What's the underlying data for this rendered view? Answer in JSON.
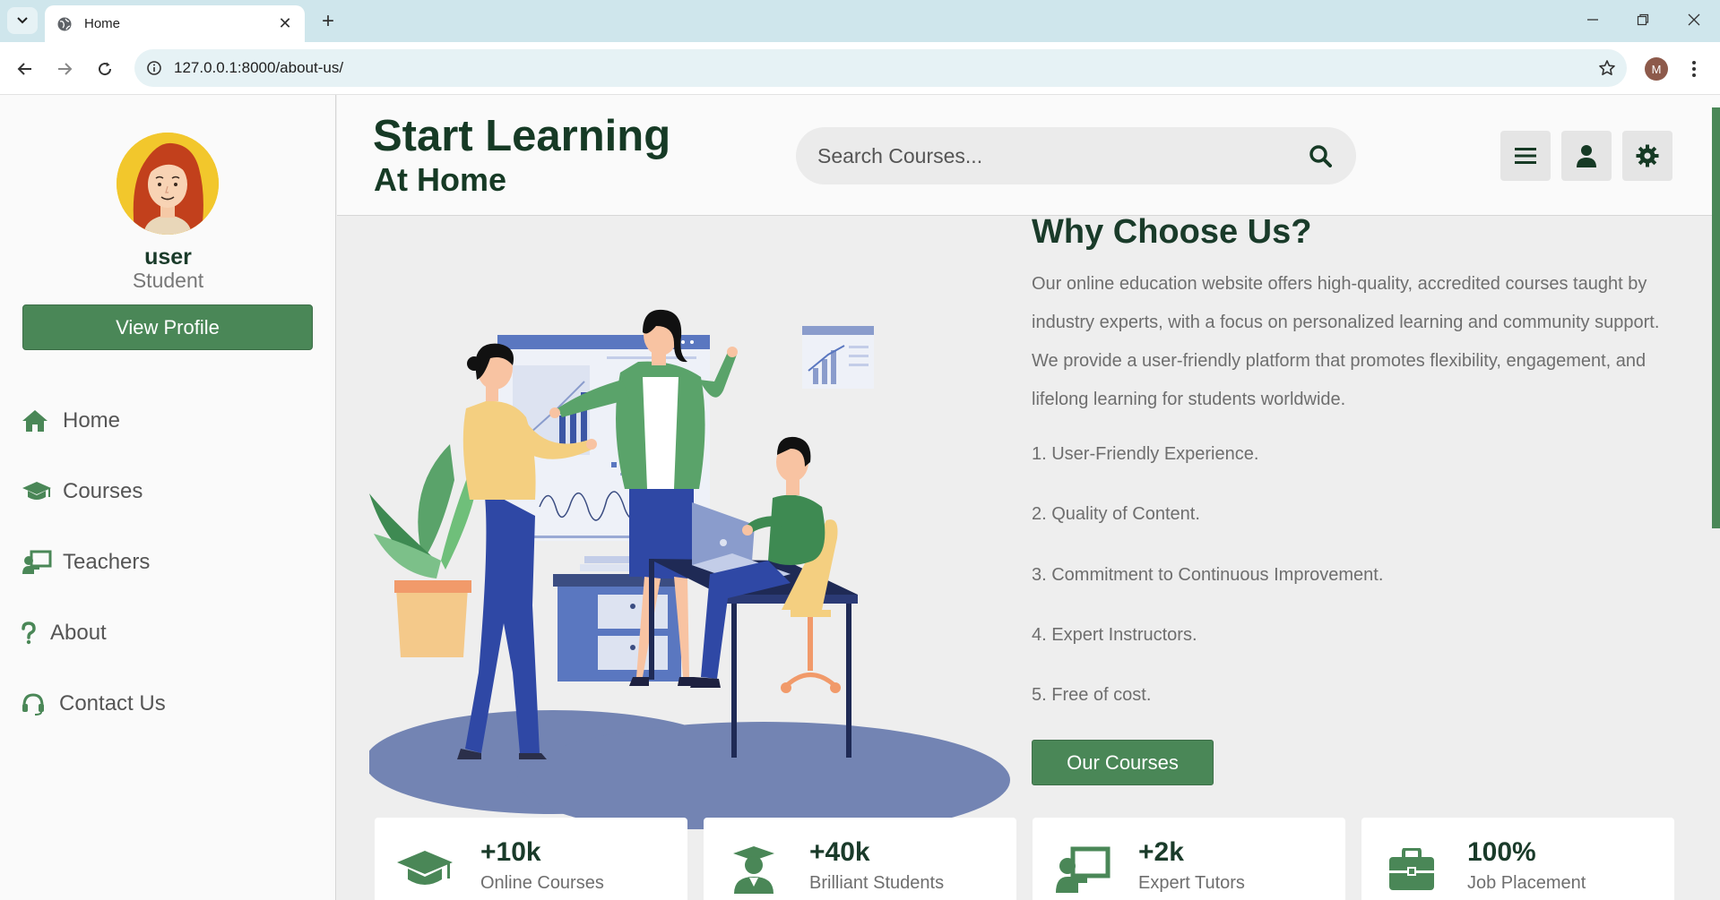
{
  "browser": {
    "tab_title": "Home",
    "url": "127.0.0.1:8000/about-us/",
    "profile_initial": "M"
  },
  "sidebar": {
    "user_name": "user",
    "user_role": "Student",
    "view_profile_label": "View Profile",
    "nav": [
      {
        "label": "Home",
        "icon": "home-icon"
      },
      {
        "label": "Courses",
        "icon": "graduation-cap-icon"
      },
      {
        "label": "Teachers",
        "icon": "chalkboard-teacher-icon"
      },
      {
        "label": "About",
        "icon": "question-icon"
      },
      {
        "label": "Contact Us",
        "icon": "headset-icon"
      }
    ]
  },
  "header": {
    "brand_line1": "Start Learning",
    "brand_line2": "At Home",
    "search_placeholder": "Search Courses..."
  },
  "about": {
    "title": "Why Choose Us?",
    "description": "Our online education website offers high-quality, accredited courses taught by industry experts, with a focus on personalized learning and community support. We provide a user-friendly platform that promotes flexibility, engagement, and lifelong learning for students worldwide.",
    "points": [
      "1. User-Friendly Experience.",
      "2. Quality of Content.",
      "3. Commitment to Continuous Improvement.",
      "4. Expert Instructors.",
      "5. Free of cost."
    ],
    "cta_label": "Our Courses"
  },
  "stats": [
    {
      "value": "+10k",
      "label": "Online Courses",
      "icon": "graduation-cap-icon"
    },
    {
      "value": "+40k",
      "label": "Brilliant Students",
      "icon": "user-graduate-icon"
    },
    {
      "value": "+2k",
      "label": "Expert Tutors",
      "icon": "chalkboard-teacher-icon"
    },
    {
      "value": "100%",
      "label": "Job Placement",
      "icon": "briefcase-icon"
    }
  ],
  "colors": {
    "primary_green": "#4a8757",
    "dark_green": "#163a25",
    "page_background": "#eeeeee"
  }
}
